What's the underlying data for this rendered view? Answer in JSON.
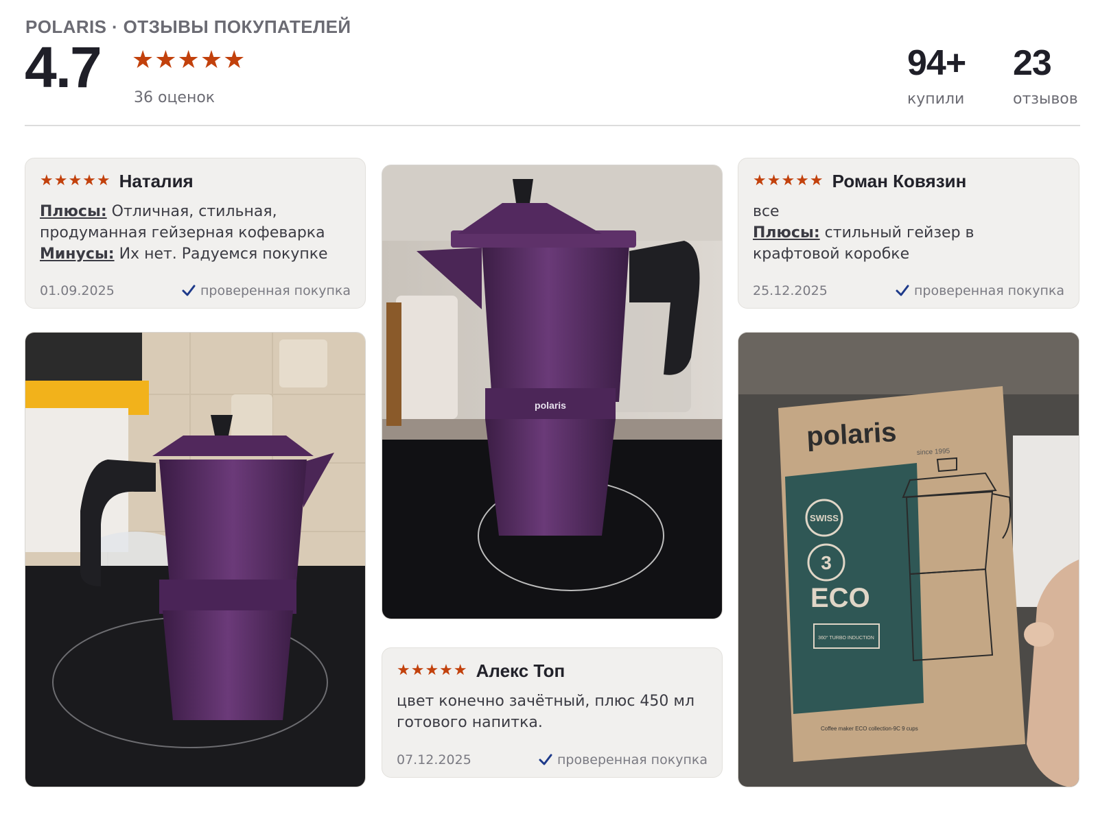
{
  "header": {
    "brand_line": "POLARIS · ОТЗЫВЫ ПОКУПАТЕЛЕЙ",
    "rating": "4.7",
    "rating_stars": "★★★★★",
    "ratings_count": "36 оценок"
  },
  "stats": {
    "bought_value": "94+",
    "bought_label": "купили",
    "reviews_value": "23",
    "reviews_label": "отзывов"
  },
  "reviews": [
    {
      "stars": "★★★★★",
      "author": "Наталия",
      "pros_label": "Плюсы:",
      "pros": "Отличная, стильная, продуманная гейзерная кофеварка",
      "cons_label": "Минусы:",
      "cons": "Их нет. Радуемся покупке",
      "date": "01.09.2025",
      "verified": "проверенная покупка"
    },
    {
      "stars": "★★★★★",
      "author": "Роман Ковязин",
      "comment": "все",
      "pros_label": "Плюсы:",
      "pros": "стильный гейзер в крафтовой коробке",
      "date": "25.12.2025",
      "verified": "проверенная покупка"
    },
    {
      "stars": "★★★★★",
      "author": "Алекс Топ",
      "comment": "цвет конечно зачётный, плюс 450 мл готового напитка.",
      "date": "07.12.2025",
      "verified": "проверенная покупка"
    }
  ],
  "photos": {
    "kettle_brand": "polaris",
    "box_brand": "polaris",
    "box_since": "since 1995",
    "box_eco": "ECO",
    "box_warranty": "3",
    "box_swiss": "SWISS",
    "box_turbo": "360° TURBO INDUCTION",
    "box_model": "Coffee maker ECO collection-9C 9 cups"
  },
  "colors": {
    "star": "#c2410c",
    "check": "#1e3a8a",
    "purple": "#5b2a67"
  }
}
